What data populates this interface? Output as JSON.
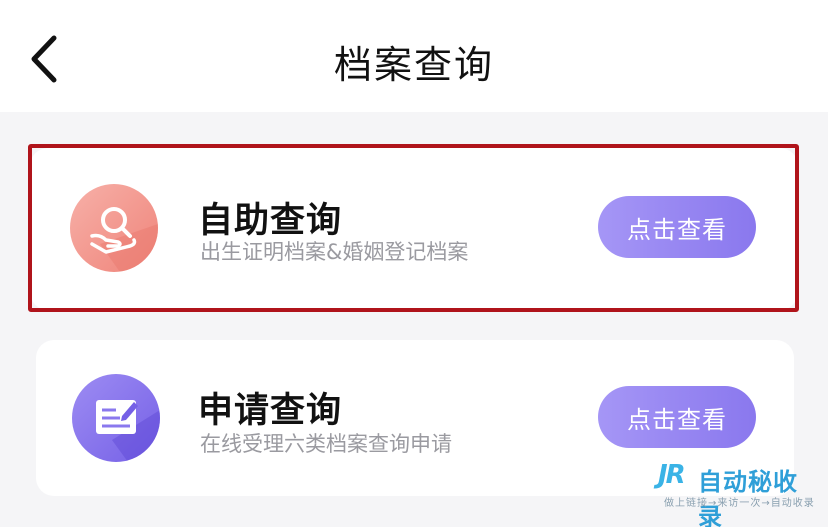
{
  "header": {
    "title": "档案查询"
  },
  "cards": [
    {
      "title": "自助查询",
      "description": "出生证明档案&婚姻登记档案",
      "button_label": "点击查看",
      "icon": "hand-search-icon",
      "icon_color": "#ef847a",
      "highlighted": true,
      "highlight_color": "#b0141b"
    },
    {
      "title": "申请查询",
      "description": "在线受理六类档案查询申请",
      "button_label": "点击查看",
      "icon": "edit-document-icon",
      "icon_color": "#7560e6",
      "highlighted": false
    }
  ],
  "button_color": "#8a78ee",
  "watermark": {
    "logo": "JR",
    "text": "自动秘收录",
    "subtitle": "做上链接→来访一次→自动收录"
  }
}
